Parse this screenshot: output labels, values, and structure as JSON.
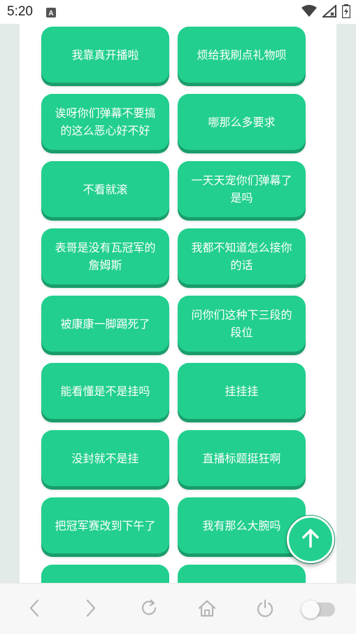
{
  "status_bar": {
    "time": "5:20",
    "badge": "A"
  },
  "buttons": [
    "我靠真开播啦",
    "烦给我刷点礼物呗",
    "诶呀你们弹幕不要搞的这么恶心好不好",
    "哪那么多要求",
    "不看就滚",
    "一天天宠你们弹幕了是吗",
    "表哥是没有瓦冠军的詹姆斯",
    "我都不知道怎么接你的话",
    "被康康一脚踢死了",
    "问你们这种下三段的段位",
    "能看懂是不是挂吗",
    "挂挂挂",
    "没封就不是挂",
    "直播标题挺狂啊",
    "把冠军赛改到下午了",
    "我有那么大腕吗"
  ],
  "colors": {
    "accent": "#22cf8e",
    "accent_dark": "#1a9d6b",
    "page_bg": "#e3ebe8"
  },
  "icons": {
    "fab": "arrow-up-icon",
    "nav": [
      "back-icon",
      "forward-icon",
      "refresh-icon",
      "home-icon",
      "power-icon"
    ]
  }
}
